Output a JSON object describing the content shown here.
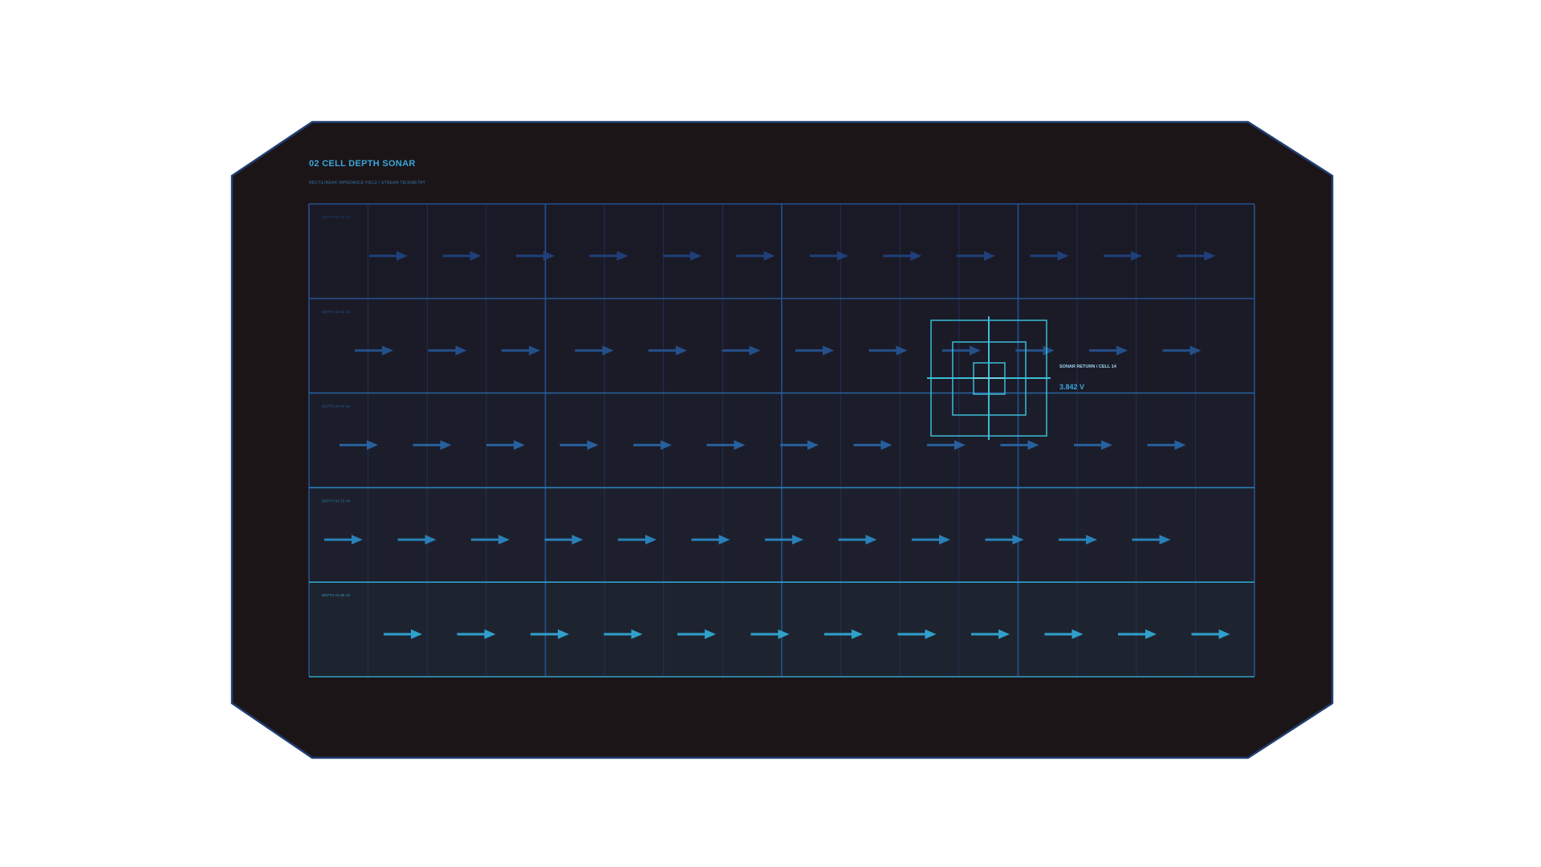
{
  "panel": {
    "title": "02  CELL DEPTH SONAR",
    "subtitle": "RECTILINEAR IMPEDANCE FIELD / STREAM TELEMETRY"
  },
  "bands": [
    {
      "label": "DEPTH 00-18 cm",
      "color": "#1f3f7a",
      "fill": "#1a1a26"
    },
    {
      "label": "DEPTH 18-36 cm",
      "color": "#24508a",
      "fill": "#1b1b28"
    },
    {
      "label": "DEPTH 36-54 cm",
      "color": "#27609c",
      "fill": "#1c1d2a"
    },
    {
      "label": "DEPTH 54-72 cm",
      "color": "#2a80b8",
      "fill": "#1d202c"
    },
    {
      "label": "DEPTH 72-90 cm",
      "color": "#30a0cc",
      "fill": "#1e242f"
    }
  ],
  "target": {
    "label": "SONAR RETURN / CELL 14",
    "value": "3.842 V",
    "color": "#3bbdd6"
  },
  "colors": {
    "background": "#ffffff",
    "panel": "#1c1517",
    "panel_border": "#1f3f72",
    "grid_major": "#24508f",
    "grid_minor": "#1f3560",
    "accent": "#39a6dc"
  }
}
